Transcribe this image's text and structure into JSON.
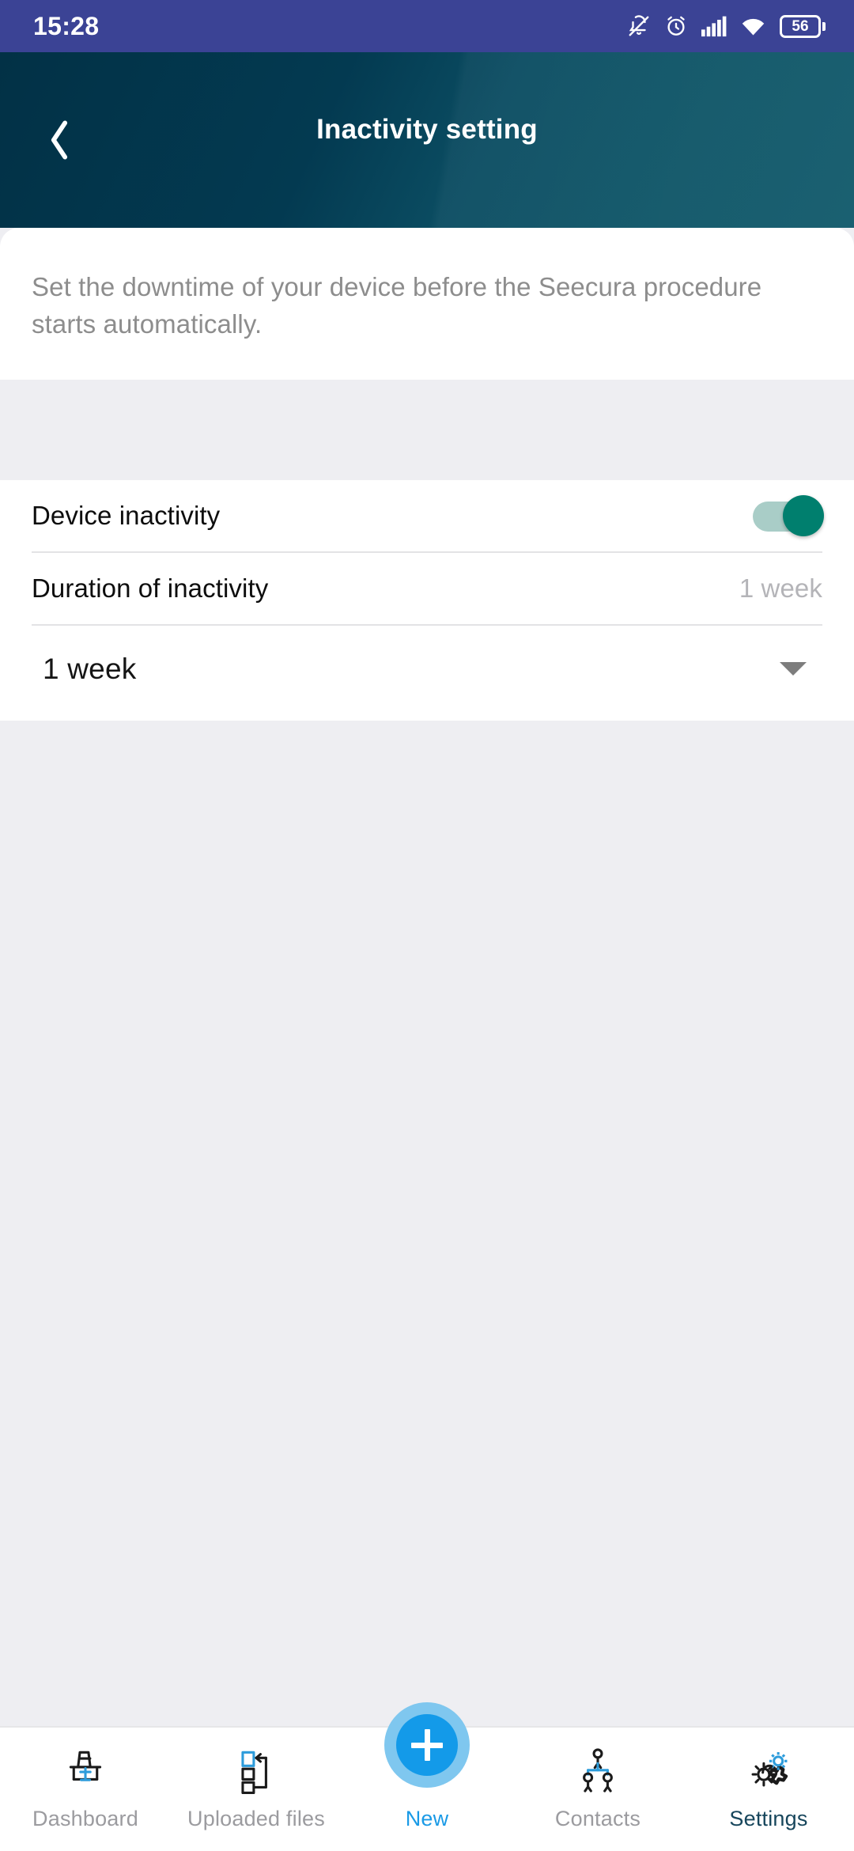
{
  "status_bar": {
    "time": "15:28",
    "battery_percent": "56",
    "icons": [
      "bell-muted-icon",
      "alarm-icon",
      "signal-icon",
      "wifi-icon",
      "battery-icon"
    ]
  },
  "app_bar": {
    "title": "Inactivity setting",
    "back_icon": "chevron-left-icon"
  },
  "content": {
    "description": "Set the downtime of your device before the Seecura procedure starts automatically.",
    "rows": [
      {
        "label": "Device inactivity",
        "type": "toggle",
        "value": "on"
      },
      {
        "label": "Duration of inactivity",
        "type": "value",
        "value": "1 week"
      }
    ],
    "dropdown": {
      "value": "1 week",
      "icon": "chevron-down-icon"
    }
  },
  "bottom_nav": {
    "items": [
      {
        "label": "Dashboard",
        "icon": "dashboard-icon",
        "active": false
      },
      {
        "label": "Uploaded files",
        "icon": "uploaded-files-icon",
        "active": false
      },
      {
        "label": "New",
        "icon": "plus-icon",
        "active": false
      },
      {
        "label": "Contacts",
        "icon": "contacts-icon",
        "active": false
      },
      {
        "label": "Settings",
        "icon": "gears-icon",
        "active": true
      }
    ]
  },
  "colors": {
    "status_bar": "#3b4395",
    "app_bar_dark": "#023146",
    "app_bar_light": "#10596b",
    "toggle_on": "#007f6e",
    "toggle_track": "#a9cdc7",
    "fab": "#139ae9",
    "fab_halo": "#7fc7ef",
    "active_nav": "#17465c",
    "inactive_nav": "#9b9b9f",
    "page_bg": "#eeeef2"
  }
}
